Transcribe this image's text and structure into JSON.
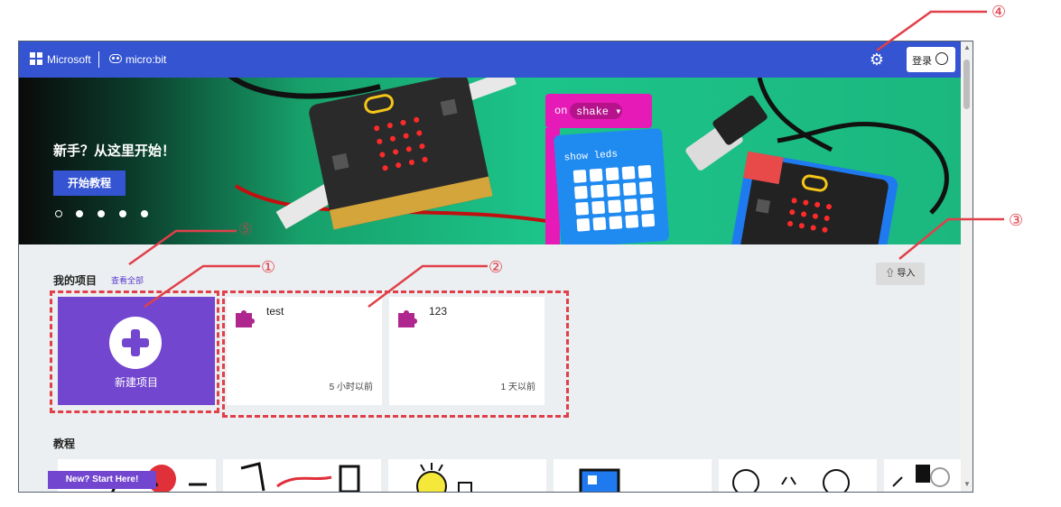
{
  "header": {
    "microsoft_label": "Microsoft",
    "product_label": "micro:bit",
    "login_label": "登录",
    "gear_icon": "gear-icon",
    "header_color": "#3454d1"
  },
  "hero": {
    "title": "新手？从这里开始！",
    "cta_label": "开始教程",
    "carousel_dots": 5,
    "block_on": "on",
    "block_shake": "shake",
    "block_show": "show leds"
  },
  "projects": {
    "section_title": "我的项目",
    "view_all": "查看全部",
    "import_label": "导入",
    "new_project_label": "新建项目",
    "items": [
      {
        "name": "test",
        "time": "5 小时以前"
      },
      {
        "name": "123",
        "time": "1 天以前"
      }
    ]
  },
  "tutorials": {
    "section_title": "教程",
    "new_start_label": "New? Start Here!"
  },
  "annotations": {
    "c1": "①",
    "c2": "②",
    "c3": "③",
    "c4": "④",
    "c5": "⑤",
    "color": "#e0404a"
  }
}
